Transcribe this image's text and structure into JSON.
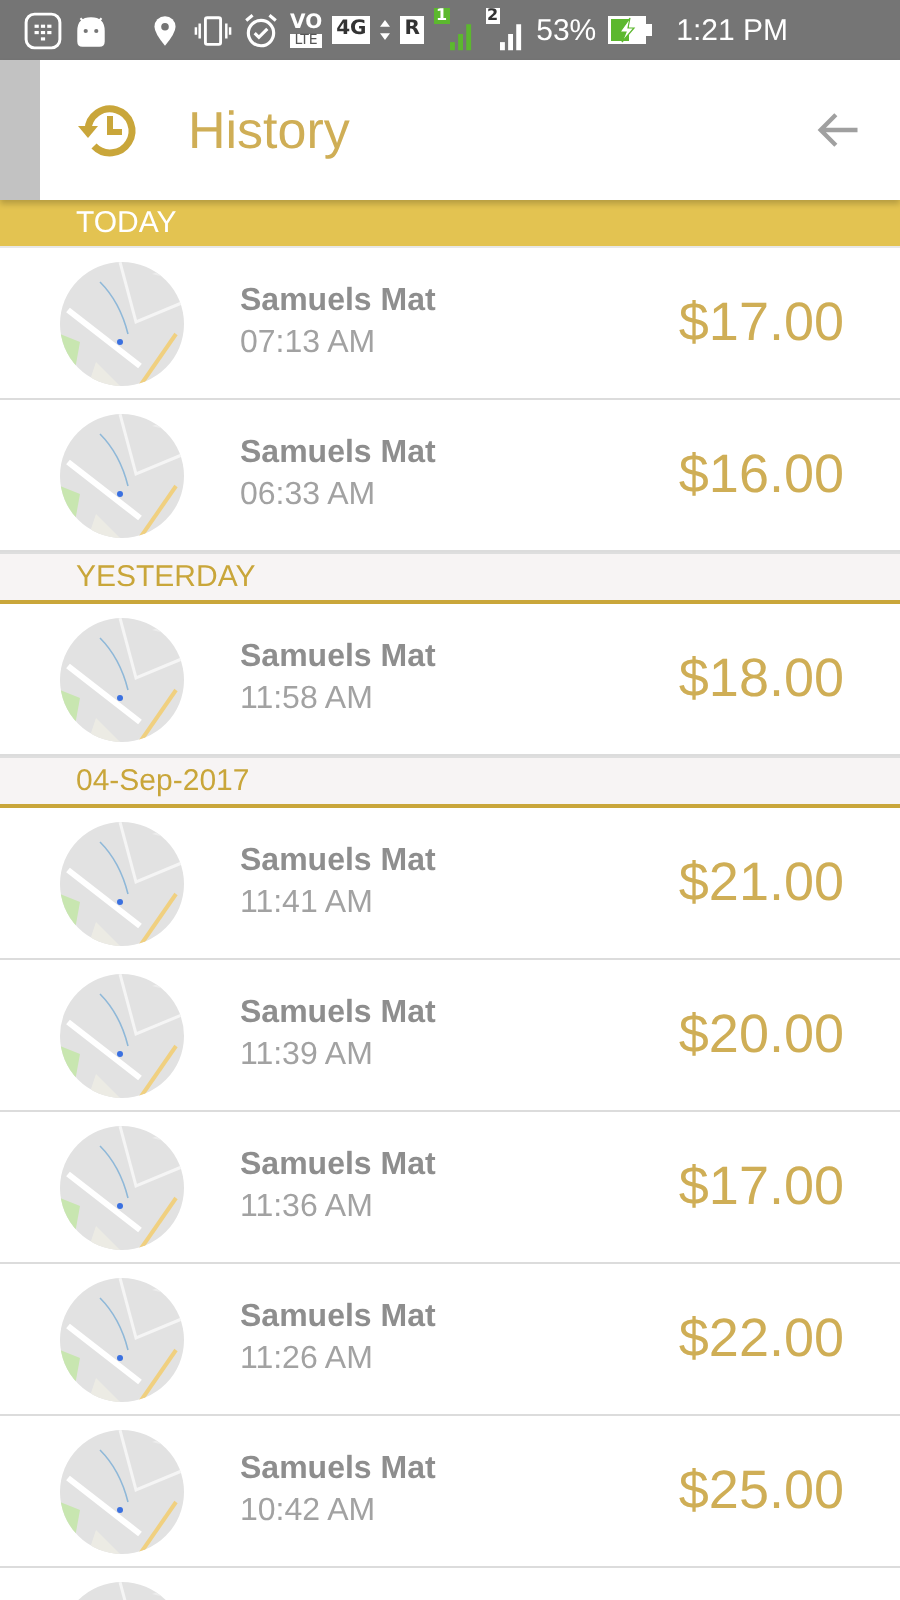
{
  "status_bar": {
    "volte_top": "VO",
    "volte_bottom": "LTE",
    "network": "4G",
    "roaming": "R",
    "sim_1": "1",
    "sim_2": "2",
    "battery": "53%",
    "time": "1:21 PM"
  },
  "header": {
    "title": "History"
  },
  "sections": [
    {
      "label": "TODAY",
      "selected": true,
      "rows": [
        {
          "kind": "trip",
          "name": "Samuels Mat",
          "time": "07:13 AM",
          "amount": "$17.00"
        },
        {
          "kind": "trip",
          "name": "Samuels Mat",
          "time": "06:33 AM",
          "amount": "$16.00"
        }
      ]
    },
    {
      "label": "YESTERDAY",
      "selected": false,
      "rows": [
        {
          "kind": "trip",
          "name": "Samuels Mat",
          "time": "11:58 AM",
          "amount": "$18.00"
        }
      ]
    },
    {
      "label": "04-Sep-2017",
      "selected": false,
      "rows": [
        {
          "kind": "trip",
          "name": "Samuels Mat",
          "time": "11:41 AM",
          "amount": "$21.00"
        },
        {
          "kind": "trip",
          "name": "Samuels Mat",
          "time": "11:39 AM",
          "amount": "$20.00"
        },
        {
          "kind": "trip",
          "name": "Samuels Mat",
          "time": "11:36 AM",
          "amount": "$17.00"
        },
        {
          "kind": "trip",
          "name": "Samuels Mat",
          "time": "11:26 AM",
          "amount": "$22.00"
        },
        {
          "kind": "trip",
          "name": "Samuels Mat",
          "time": "10:42 AM",
          "amount": "$25.00"
        },
        {
          "kind": "picture"
        }
      ]
    }
  ]
}
